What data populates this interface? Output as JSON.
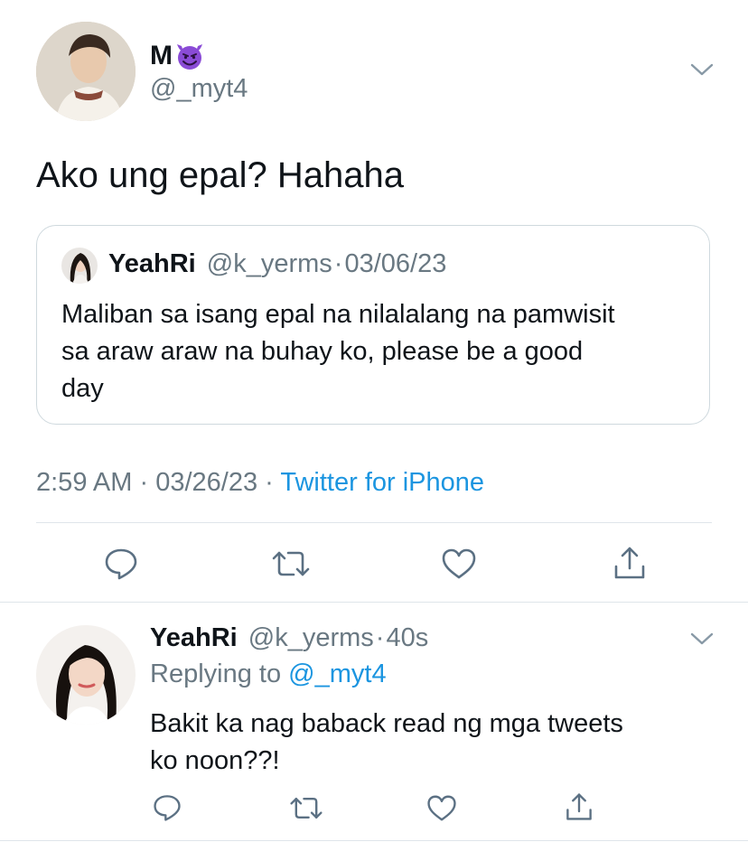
{
  "main_tweet": {
    "display_name": "M",
    "handle": "@_myt4",
    "text": "Ako ung epal? Hahaha",
    "quoted": {
      "display_name": "YeahRi",
      "handle": "@k_yerms",
      "dot": "·",
      "date": "03/06/23",
      "text_line1": "Maliban sa isang epal na nilalalang na pamwisit",
      "text_line2": "sa araw araw na buhay ko, please be a good",
      "text_line3": "day"
    },
    "time": "2:59 AM",
    "sep": "·",
    "date": "03/26/23",
    "sep2": "·",
    "source": "Twitter for iPhone"
  },
  "reply": {
    "display_name": "YeahRi",
    "handle": "@k_yerms",
    "dot": "·",
    "age": "40s",
    "replying_to_label": "Replying to",
    "replying_to_handle": "@_myt4",
    "text_line1": "Bakit ka nag baback read ng mga tweets",
    "text_line2": "ko noon??!"
  },
  "icons": {
    "emoji": "smiling-devil-emoji",
    "actions": [
      "reply-icon",
      "retweet-icon",
      "like-icon",
      "share-icon"
    ]
  },
  "colors": {
    "text": "#0f1419",
    "muted": "#697882",
    "link": "#1b95e0",
    "emoji": "#8a4bd6"
  }
}
